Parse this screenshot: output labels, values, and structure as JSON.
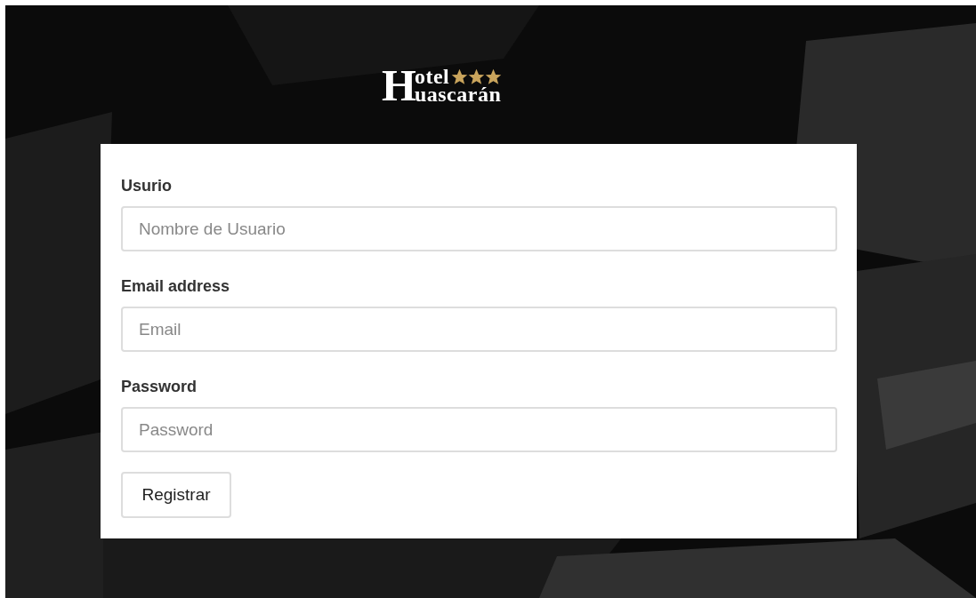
{
  "logo": {
    "initial": "H",
    "line_1": "otel",
    "line_2": "uascarán",
    "stars": 3
  },
  "form": {
    "fields": [
      {
        "label": "Usurio",
        "placeholder": "Nombre de Usuario"
      },
      {
        "label": "Email address",
        "placeholder": "Email"
      },
      {
        "label": "Password",
        "placeholder": "Password"
      }
    ],
    "button": "Registrar"
  }
}
